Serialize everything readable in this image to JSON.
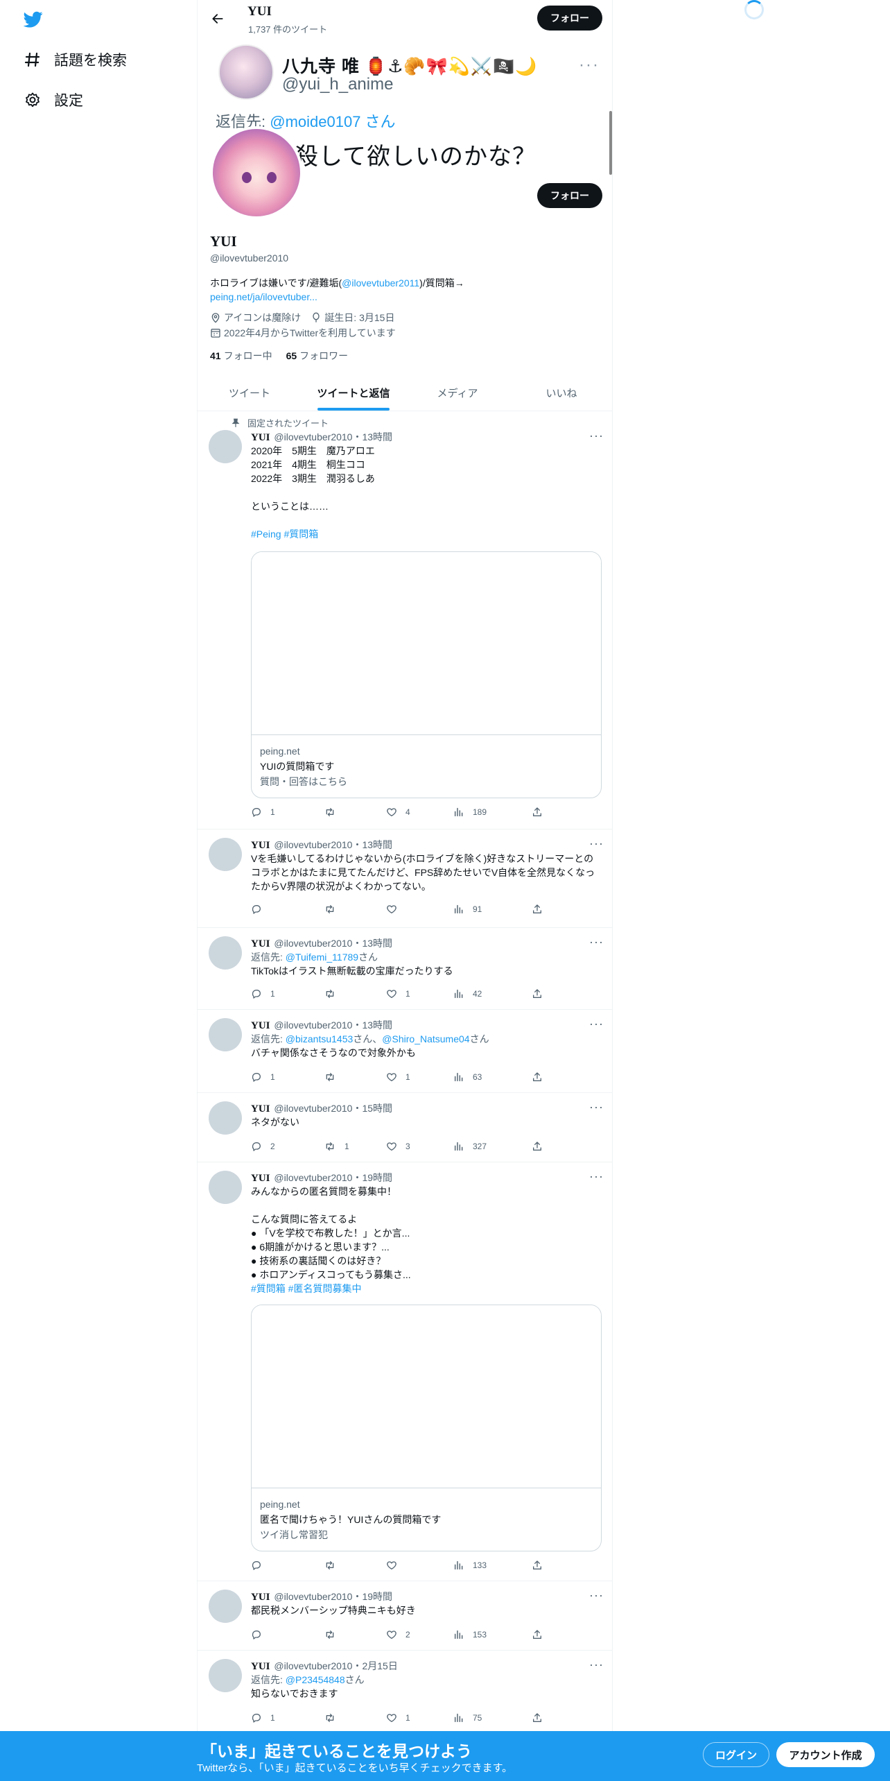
{
  "sidebar": {
    "items": [
      {
        "label": "話題を検索",
        "icon": "hashtag-icon"
      },
      {
        "label": "設定",
        "icon": "gear-icon"
      }
    ]
  },
  "header": {
    "title": "YUI",
    "tweet_count": "1,737 件のツイート",
    "follow_label": "フォロー"
  },
  "banner": {
    "name": "八九寺 唯 🏮⚓🥐🎀💫⚔️🏴‍☠️🌙",
    "handle": "@yui_h_anime",
    "reply_prefix": "返信先: ",
    "reply_to": "@moide0107 さん",
    "text": "殺して欲しいのかな？",
    "more": "···"
  },
  "profile": {
    "name": "YUI",
    "handle": "@ilovevtuber2010",
    "follow_label": "フォロー",
    "bio_1": "ホロライブは嫌いです/避難垢(",
    "bio_link": "@ilovevtuber2011",
    "bio_2": ")/質問箱→",
    "bio_url": "peing.net/ja/ilovevtuber...",
    "location": "アイコンは魔除け",
    "birthday": "誕生日: 3月15日",
    "joined": "2022年4月からTwitterを利用しています",
    "following_count": "41",
    "following_label": "フォロー中",
    "followers_count": "65",
    "followers_label": "フォロワー"
  },
  "tabs": [
    {
      "label": "ツイート"
    },
    {
      "label": "ツイートと返信"
    },
    {
      "label": "メディア"
    },
    {
      "label": "いいね"
    }
  ],
  "pinned_label": "固定されたツイート",
  "tweets": [
    {
      "name": "YUI",
      "meta": "@ilovevtuber2010・13時間",
      "text": "2020年　5期生　魔乃アロエ\n2021年　4期生　桐生ココ\n2022年　3期生　潤羽るしあ\n\nということは……",
      "hashtags": "#Peing #質問箱",
      "card": {
        "domain": "peing.net",
        "title": "YUIの質問箱です",
        "desc": "質問・回答はこちら"
      },
      "replies": "1",
      "retweets": "",
      "likes": "4",
      "views": "189"
    },
    {
      "name": "YUI",
      "meta": "@ilovevtuber2010・13時間",
      "text": "Vを毛嫌いしてるわけじゃないから(ホロライブを除く)好きなストリーマーとのコラボとかはたまに見てたんだけど、FPS辞めたせいでV自体を全然見なくなったからV界隈の状況がよくわかってない。",
      "replies": "",
      "retweets": "",
      "likes": "",
      "views": "91"
    },
    {
      "name": "YUI",
      "meta": "@ilovevtuber2010・13時間",
      "reply_prefix": "返信先: ",
      "reply_to": "@Tuifemi_11789",
      "reply_suffix": "さん",
      "text": "TikTokはイラスト無断転載の宝庫だったりする",
      "replies": "1",
      "retweets": "",
      "likes": "1",
      "views": "42"
    },
    {
      "name": "YUI",
      "meta": "@ilovevtuber2010・13時間",
      "reply_prefix": "返信先: ",
      "reply_to": "@bizantsu1453",
      "reply_mid": "さん、",
      "reply_to2": "@Shiro_Natsume04",
      "reply_suffix": "さん",
      "text": "バチャ関係なさそうなので対象外かも",
      "replies": "1",
      "retweets": "",
      "likes": "1",
      "views": "63"
    },
    {
      "name": "YUI",
      "meta": "@ilovevtuber2010・15時間",
      "text": "ネタがない",
      "replies": "2",
      "retweets": "1",
      "likes": "3",
      "views": "327"
    },
    {
      "name": "YUI",
      "meta": "@ilovevtuber2010・19時間",
      "text": "みんなからの匿名質問を募集中！\n\nこんな質問に答えてるよ\n● 「Vを学校で布教した！」とか言...\n● 6期誰がかけると思います？...\n● 技術系の裏話聞くのは好き？\n● ホロアンディスコってもう募集さ...",
      "hashtags": "#質問箱 #匿名質問募集中",
      "card": {
        "domain": "peing.net",
        "title": "匿名で聞けちゃう！YUIさんの質問箱です",
        "desc": "ツイ消し常習犯"
      },
      "replies": "",
      "retweets": "",
      "likes": "",
      "views": "133"
    },
    {
      "name": "YUI",
      "meta": "@ilovevtuber2010・19時間",
      "text": "都民税メンバーシップ特典ニキも好き",
      "replies": "",
      "retweets": "",
      "likes": "2",
      "views": "153"
    },
    {
      "name": "YUI",
      "meta": "@ilovevtuber2010・2月15日",
      "reply_prefix": "返信先: ",
      "reply_to": "@P23454848",
      "reply_suffix": "さん",
      "text": "知らないでおきます",
      "replies": "1",
      "retweets": "",
      "likes": "1",
      "views": "75"
    }
  ],
  "bottom": {
    "title": "「いま」起きていることを見つけよう",
    "subtitle": "Twitterなら、「いま」起きていることをいち早くチェックできます。",
    "login": "ログイン",
    "signup": "アカウント作成"
  },
  "colors": {
    "accent": "#1d9bf0",
    "text": "#0f1419",
    "muted": "#536471"
  }
}
